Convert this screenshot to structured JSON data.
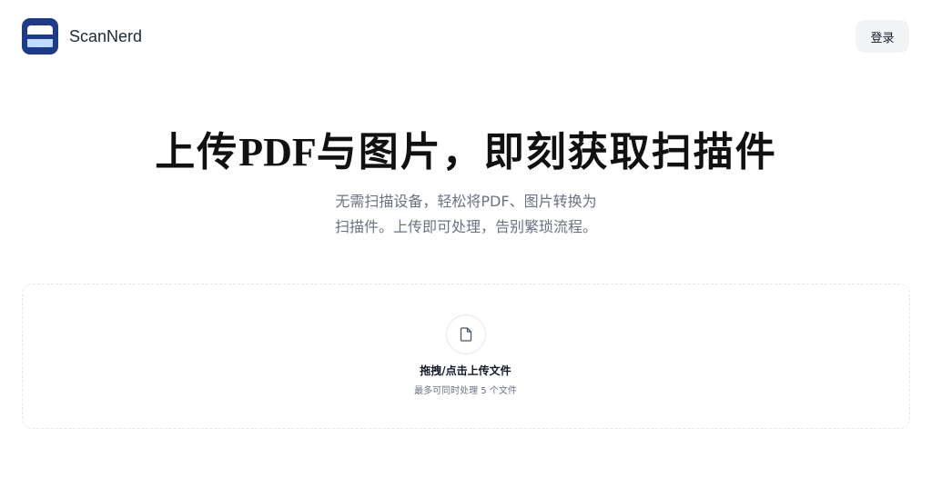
{
  "header": {
    "brand": "ScanNerd",
    "logo_icon": "document-scan-icon",
    "login_label": "登录"
  },
  "hero": {
    "title_part1": "上传",
    "title_part2": "PDF",
    "title_part3": "与图片，即刻获取扫描件",
    "subtitle_line1": "无需扫描设备，轻松将PDF、图片转换为",
    "subtitle_line2": "扫描件。上传即可处理，告别繁琐流程。"
  },
  "dropzone": {
    "icon": "file-icon",
    "title": "拖拽/点击上传文件",
    "hint": "最多可同时处理 5 个文件"
  },
  "colors": {
    "brand_blue": "#1e3a8a",
    "text_dark": "#111827",
    "text_muted": "#6b7280",
    "button_bg": "#f3f4f6",
    "border": "#e5e7eb"
  }
}
